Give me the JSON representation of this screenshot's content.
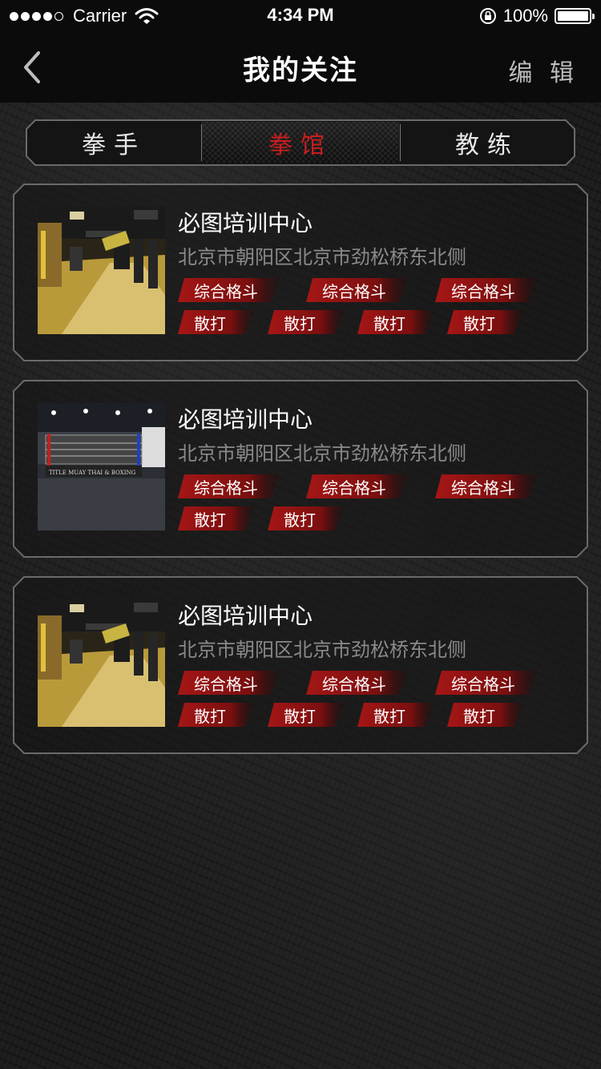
{
  "status_bar": {
    "carrier": "Carrier",
    "time": "4:34 PM",
    "battery": "100%"
  },
  "nav": {
    "title": "我的关注",
    "edit": "编 辑"
  },
  "tabs": [
    {
      "label": "拳手",
      "active": false
    },
    {
      "label": "拳馆",
      "active": true
    },
    {
      "label": "教练",
      "active": false
    }
  ],
  "colors": {
    "accent_red": "#c81e1e",
    "tag_red": "#9e1414",
    "frame_gray": "#6a6a6a"
  },
  "cards": [
    {
      "name": "必图培训中心",
      "address": "北京市朝阳区北京市劲松桥东北侧",
      "thumb": "gym-interior",
      "tags_row1": [
        "综合格斗",
        "综合格斗",
        "综合格斗"
      ],
      "tags_row2": [
        "散打",
        "散打",
        "散打",
        "散打"
      ]
    },
    {
      "name": "必图培训中心",
      "address": "北京市朝阳区北京市劲松桥东北侧",
      "thumb": "boxing-ring",
      "tags_row1": [
        "综合格斗",
        "综合格斗",
        "综合格斗"
      ],
      "tags_row2": [
        "散打",
        "散打"
      ]
    },
    {
      "name": "必图培训中心",
      "address": "北京市朝阳区北京市劲松桥东北侧",
      "thumb": "gym-interior",
      "tags_row1": [
        "综合格斗",
        "综合格斗",
        "综合格斗"
      ],
      "tags_row2": [
        "散打",
        "散打",
        "散打",
        "散打"
      ]
    }
  ]
}
